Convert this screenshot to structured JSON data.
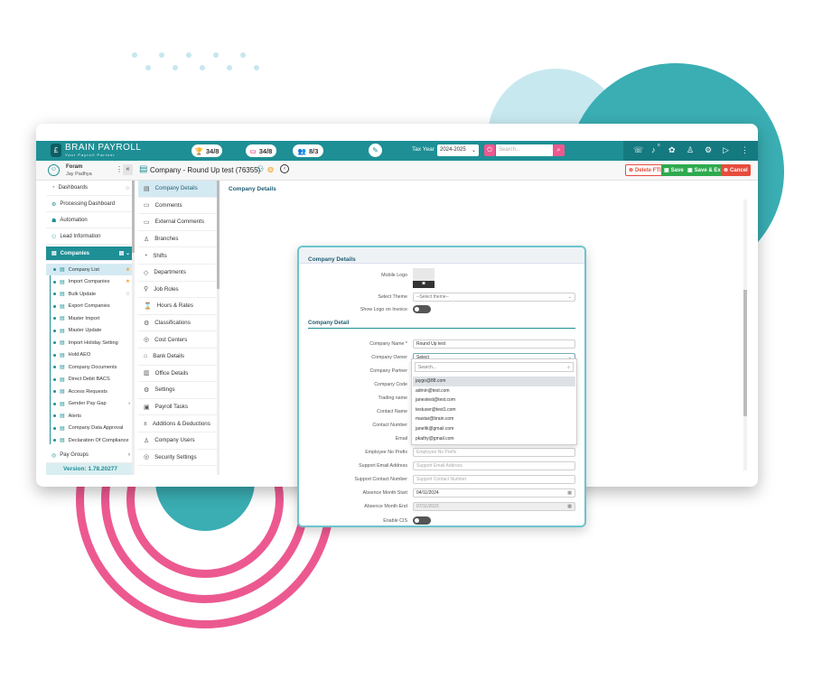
{
  "app": {
    "brand": "BRAIN PAYROLL",
    "tagline": "Your Payroll Partner"
  },
  "topbar": {
    "counters": [
      {
        "icon": "trophy-icon",
        "value": "34/8"
      },
      {
        "icon": "card-icon",
        "value": "34/8"
      },
      {
        "icon": "users-icon",
        "value": "8/3"
      }
    ],
    "tax_year_label": "Tax Year",
    "tax_year_value": "2024-2025",
    "search_placeholder": "Search...",
    "badge": "0"
  },
  "user": {
    "name": "Foram",
    "sub": "Jay Padhya"
  },
  "sidebar": {
    "items": [
      {
        "label": "Dashboards",
        "icon": "dashboard-icon"
      },
      {
        "label": "Processing Dashboard",
        "icon": "gear-icon"
      },
      {
        "label": "Automation",
        "icon": "robot-icon"
      },
      {
        "label": "Lead Information",
        "icon": "people-icon"
      }
    ],
    "section": "Companies",
    "subitems": [
      "Company List",
      "Import Companies",
      "Bulk Update",
      "Export Companies",
      "Master Import",
      "Master Update",
      "Import Holiday Setting",
      "Hold AEO",
      "Company Documents",
      "Direct Debit BACS",
      "Access Requests",
      "Gender Pay Gap",
      "Alerts",
      "Company Data Approval",
      "Declaration Of Compliance"
    ],
    "pay_groups": "Pay Groups",
    "version": "Version: 1.78.20277"
  },
  "header": {
    "title": "Company - Round Up test (76355)"
  },
  "actions": {
    "delete": "Delete FTI",
    "save": "Save",
    "save_exit": "Save & Exit",
    "cancel": "Cancel"
  },
  "midmenu": [
    "Company Details",
    "Comments",
    "External Comments",
    "Branches",
    "Shifts",
    "Departments",
    "Job Roles",
    "Hours & Rates",
    "Classifications",
    "Cost Centers",
    "Bank Details",
    "Office Details",
    "Settings",
    "Payroll Tasks",
    "Additions & Deductions",
    "Company Users",
    "Security Settings"
  ],
  "content": {
    "heading": "Company Details"
  },
  "modal": {
    "heading": "Company Details",
    "mobile_logo": "Mobile Logo",
    "select_theme": "Select Theme",
    "theme_value": "--Select theme--",
    "show_logo": "Show Logo on Invoice",
    "section": "Company Detail",
    "fields": [
      {
        "label": "Company Name *",
        "value": "Round Up test"
      },
      {
        "label": "Company Owner",
        "value": "Select"
      },
      {
        "label": "Company Partner",
        "value": "Search..."
      },
      {
        "label": "Company Code",
        "value": ""
      },
      {
        "label": "Trading name",
        "value": ""
      },
      {
        "label": "Contact Name",
        "value": ""
      },
      {
        "label": "Contact Number",
        "value": ""
      },
      {
        "label": "Email",
        "value": ""
      },
      {
        "label": "Employee No Prefix",
        "placeholder": "Employee No Prefix"
      },
      {
        "label": "Support Email Address",
        "placeholder": "Support Email Address"
      },
      {
        "label": "Support Contact Number",
        "placeholder": "Support Contact Number"
      },
      {
        "label": "Absence Month Start",
        "value": "04/11/2024"
      },
      {
        "label": "Absence Month End",
        "value": "07/11/2023"
      },
      {
        "label": "Enable CIS",
        "value": ""
      }
    ],
    "dropdown_options": [
      "jaygo@88.com",
      "admin@test.com",
      "janestest@test.com",
      "testuser@test1.com",
      "mastar@brain.com",
      "janeltk@gmail.com",
      "pkathy@gmail.com"
    ]
  },
  "colors": {
    "teal": "#1e8f95",
    "pink": "#ec5990",
    "light_teal": "#c7e7ef",
    "circle_teal": "#3aaeb3"
  }
}
